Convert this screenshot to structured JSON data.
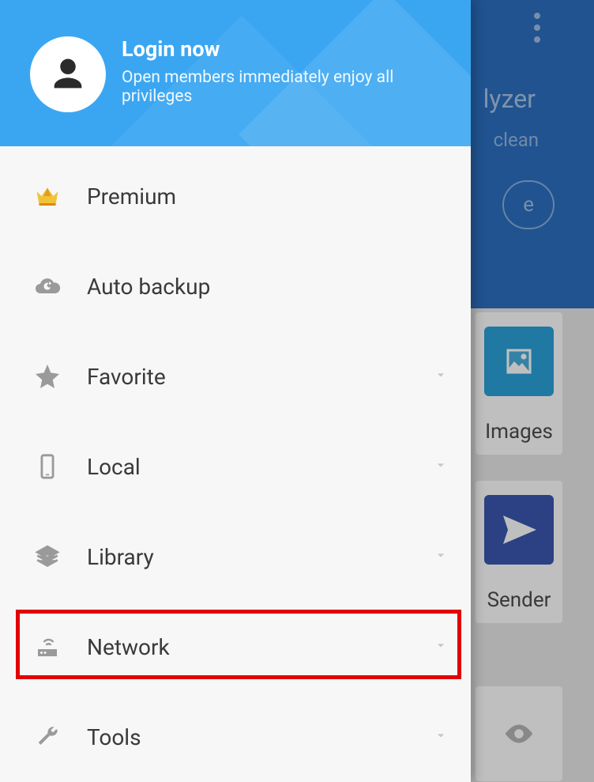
{
  "background": {
    "analyzer_partial": "lyzer",
    "clean_partial": "clean",
    "button_partial": "e",
    "images_label": "Images",
    "sender_label": "Sender"
  },
  "header": {
    "login_title": "Login now",
    "login_subtitle": "Open members immediately enjoy all privileges"
  },
  "menu": {
    "items": [
      {
        "label": "Premium",
        "expandable": false
      },
      {
        "label": "Auto backup",
        "expandable": false
      },
      {
        "label": "Favorite",
        "expandable": true
      },
      {
        "label": "Local",
        "expandable": true
      },
      {
        "label": "Library",
        "expandable": true
      },
      {
        "label": "Network",
        "expandable": true
      },
      {
        "label": "Tools",
        "expandable": true
      }
    ]
  },
  "highlight": {
    "target": "Network"
  }
}
